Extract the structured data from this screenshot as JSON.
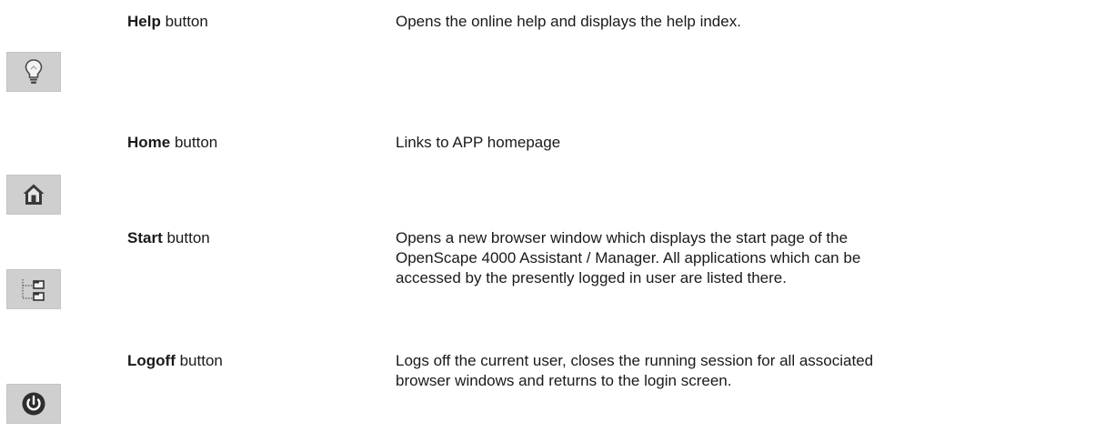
{
  "rows": [
    {
      "icon": "lightbulb-icon",
      "name": "Help",
      "suffix": "button",
      "description": [
        "Opens the online help and displays the help index."
      ]
    },
    {
      "icon": "home-icon",
      "name": "Home",
      "suffix": "button",
      "description": [
        "Links to APP homepage"
      ]
    },
    {
      "icon": "tree-structure-icon",
      "name": "Start",
      "suffix": "button",
      "description": [
        "Opens a new browser window which displays the start page of the",
        "OpenScape 4000 Assistant / Manager. All applications which can be",
        "accessed by the presently logged in user are listed there."
      ]
    },
    {
      "icon": "power-icon",
      "name": "Logoff",
      "suffix": "button",
      "description": [
        "Logs off the current user, closes the running session for all associated",
        "browser windows and returns to the login screen."
      ]
    }
  ]
}
